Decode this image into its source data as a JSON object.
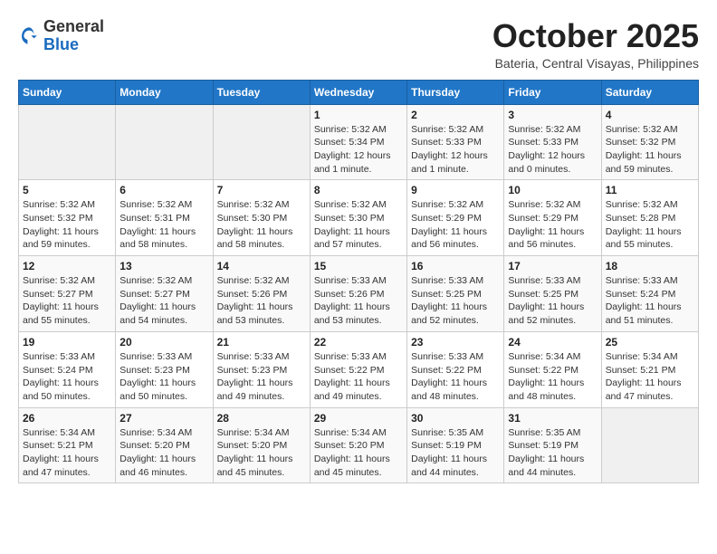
{
  "logo": {
    "general": "General",
    "blue": "Blue"
  },
  "title": {
    "month": "October 2025",
    "location": "Bateria, Central Visayas, Philippines"
  },
  "headers": [
    "Sunday",
    "Monday",
    "Tuesday",
    "Wednesday",
    "Thursday",
    "Friday",
    "Saturday"
  ],
  "weeks": [
    [
      {
        "day": "",
        "info": ""
      },
      {
        "day": "",
        "info": ""
      },
      {
        "day": "",
        "info": ""
      },
      {
        "day": "1",
        "info": "Sunrise: 5:32 AM\nSunset: 5:34 PM\nDaylight: 12 hours\nand 1 minute."
      },
      {
        "day": "2",
        "info": "Sunrise: 5:32 AM\nSunset: 5:33 PM\nDaylight: 12 hours\nand 1 minute."
      },
      {
        "day": "3",
        "info": "Sunrise: 5:32 AM\nSunset: 5:33 PM\nDaylight: 12 hours\nand 0 minutes."
      },
      {
        "day": "4",
        "info": "Sunrise: 5:32 AM\nSunset: 5:32 PM\nDaylight: 11 hours\nand 59 minutes."
      }
    ],
    [
      {
        "day": "5",
        "info": "Sunrise: 5:32 AM\nSunset: 5:32 PM\nDaylight: 11 hours\nand 59 minutes."
      },
      {
        "day": "6",
        "info": "Sunrise: 5:32 AM\nSunset: 5:31 PM\nDaylight: 11 hours\nand 58 minutes."
      },
      {
        "day": "7",
        "info": "Sunrise: 5:32 AM\nSunset: 5:30 PM\nDaylight: 11 hours\nand 58 minutes."
      },
      {
        "day": "8",
        "info": "Sunrise: 5:32 AM\nSunset: 5:30 PM\nDaylight: 11 hours\nand 57 minutes."
      },
      {
        "day": "9",
        "info": "Sunrise: 5:32 AM\nSunset: 5:29 PM\nDaylight: 11 hours\nand 56 minutes."
      },
      {
        "day": "10",
        "info": "Sunrise: 5:32 AM\nSunset: 5:29 PM\nDaylight: 11 hours\nand 56 minutes."
      },
      {
        "day": "11",
        "info": "Sunrise: 5:32 AM\nSunset: 5:28 PM\nDaylight: 11 hours\nand 55 minutes."
      }
    ],
    [
      {
        "day": "12",
        "info": "Sunrise: 5:32 AM\nSunset: 5:27 PM\nDaylight: 11 hours\nand 55 minutes."
      },
      {
        "day": "13",
        "info": "Sunrise: 5:32 AM\nSunset: 5:27 PM\nDaylight: 11 hours\nand 54 minutes."
      },
      {
        "day": "14",
        "info": "Sunrise: 5:32 AM\nSunset: 5:26 PM\nDaylight: 11 hours\nand 53 minutes."
      },
      {
        "day": "15",
        "info": "Sunrise: 5:33 AM\nSunset: 5:26 PM\nDaylight: 11 hours\nand 53 minutes."
      },
      {
        "day": "16",
        "info": "Sunrise: 5:33 AM\nSunset: 5:25 PM\nDaylight: 11 hours\nand 52 minutes."
      },
      {
        "day": "17",
        "info": "Sunrise: 5:33 AM\nSunset: 5:25 PM\nDaylight: 11 hours\nand 52 minutes."
      },
      {
        "day": "18",
        "info": "Sunrise: 5:33 AM\nSunset: 5:24 PM\nDaylight: 11 hours\nand 51 minutes."
      }
    ],
    [
      {
        "day": "19",
        "info": "Sunrise: 5:33 AM\nSunset: 5:24 PM\nDaylight: 11 hours\nand 50 minutes."
      },
      {
        "day": "20",
        "info": "Sunrise: 5:33 AM\nSunset: 5:23 PM\nDaylight: 11 hours\nand 50 minutes."
      },
      {
        "day": "21",
        "info": "Sunrise: 5:33 AM\nSunset: 5:23 PM\nDaylight: 11 hours\nand 49 minutes."
      },
      {
        "day": "22",
        "info": "Sunrise: 5:33 AM\nSunset: 5:22 PM\nDaylight: 11 hours\nand 49 minutes."
      },
      {
        "day": "23",
        "info": "Sunrise: 5:33 AM\nSunset: 5:22 PM\nDaylight: 11 hours\nand 48 minutes."
      },
      {
        "day": "24",
        "info": "Sunrise: 5:34 AM\nSunset: 5:22 PM\nDaylight: 11 hours\nand 48 minutes."
      },
      {
        "day": "25",
        "info": "Sunrise: 5:34 AM\nSunset: 5:21 PM\nDaylight: 11 hours\nand 47 minutes."
      }
    ],
    [
      {
        "day": "26",
        "info": "Sunrise: 5:34 AM\nSunset: 5:21 PM\nDaylight: 11 hours\nand 47 minutes."
      },
      {
        "day": "27",
        "info": "Sunrise: 5:34 AM\nSunset: 5:20 PM\nDaylight: 11 hours\nand 46 minutes."
      },
      {
        "day": "28",
        "info": "Sunrise: 5:34 AM\nSunset: 5:20 PM\nDaylight: 11 hours\nand 45 minutes."
      },
      {
        "day": "29",
        "info": "Sunrise: 5:34 AM\nSunset: 5:20 PM\nDaylight: 11 hours\nand 45 minutes."
      },
      {
        "day": "30",
        "info": "Sunrise: 5:35 AM\nSunset: 5:19 PM\nDaylight: 11 hours\nand 44 minutes."
      },
      {
        "day": "31",
        "info": "Sunrise: 5:35 AM\nSunset: 5:19 PM\nDaylight: 11 hours\nand 44 minutes."
      },
      {
        "day": "",
        "info": ""
      }
    ]
  ]
}
